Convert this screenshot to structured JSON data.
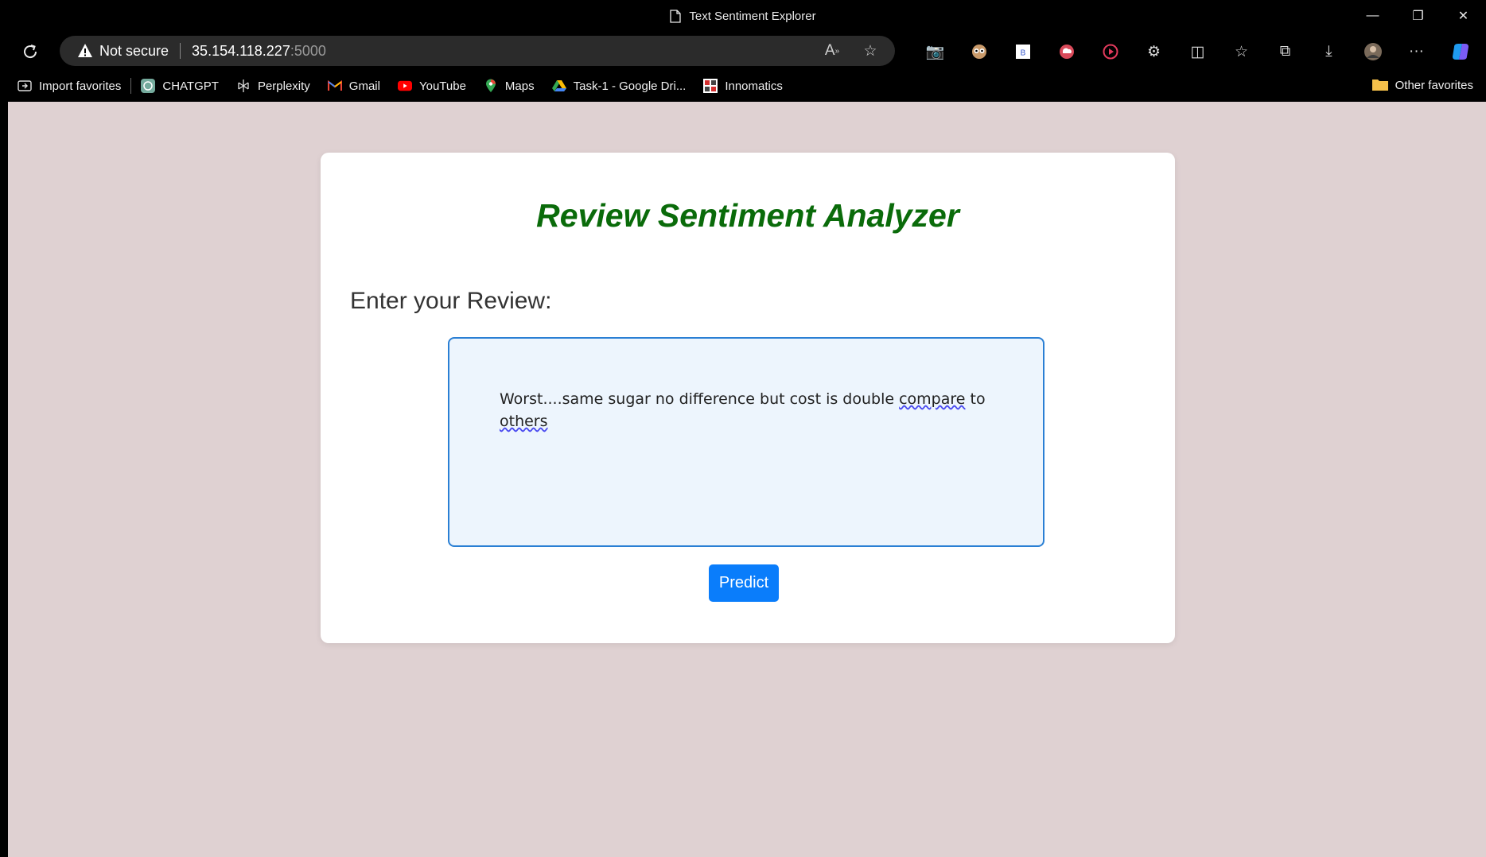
{
  "window": {
    "title": "Text Sentiment Explorer",
    "controls": [
      "—",
      "❐",
      "✕"
    ]
  },
  "toolbar": {
    "security_label": "Not secure",
    "url_host": "35.154.118.227",
    "url_port": ":5000"
  },
  "bookmarks": {
    "items": [
      {
        "label": "Import favorites",
        "icon": "import-icon"
      },
      {
        "label": "CHATGPT",
        "icon": "chatgpt-icon"
      },
      {
        "label": "Perplexity",
        "icon": "perplexity-icon"
      },
      {
        "label": "Gmail",
        "icon": "gmail-icon"
      },
      {
        "label": "YouTube",
        "icon": "youtube-icon"
      },
      {
        "label": "Maps",
        "icon": "maps-icon"
      },
      {
        "label": "Task-1 - Google Dri...",
        "icon": "google-drive-icon"
      },
      {
        "label": "Innomatics",
        "icon": "innomatics-icon"
      }
    ],
    "other": "Other favorites"
  },
  "main": {
    "heading": "Review Sentiment Analyzer",
    "label": "Enter your Review:",
    "review_text_a": "Worst....same sugar no difference but cost is double ",
    "review_text_b": "compare",
    "review_text_c": " to ",
    "review_text_d": "others",
    "predict_label": "Predict"
  },
  "colors": {
    "page_background": "#dfd1d2",
    "heading": "#0a6b0a",
    "textarea_background": "#edf5fd",
    "textarea_border": "#2a7fd4",
    "button": "#0a7dfb"
  }
}
